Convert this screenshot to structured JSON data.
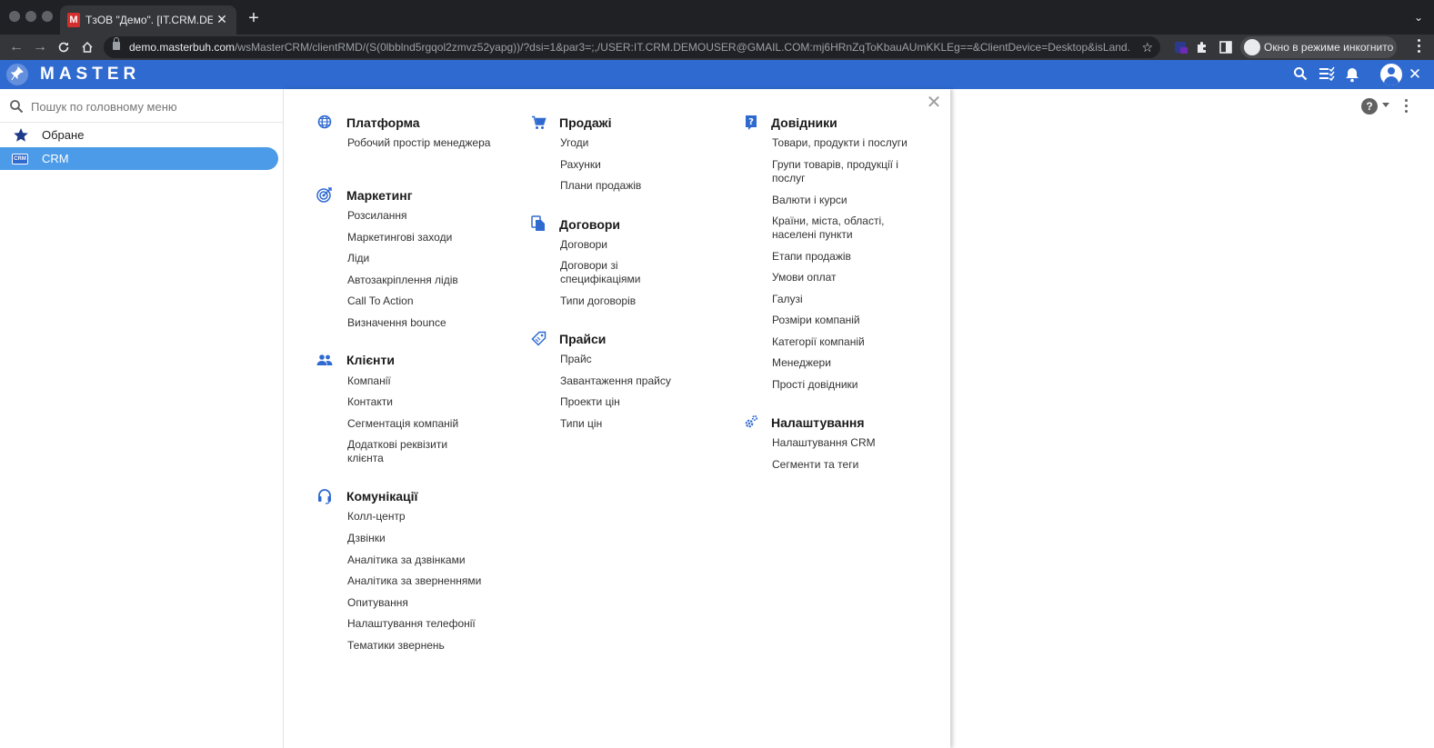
{
  "browser": {
    "tab_title": "ТзОВ \"Демо\". [IT.CRM.DEMOUSER",
    "tab_favicon": "M",
    "new_tab": "+",
    "url_host": "demo.masterbuh.com",
    "url_path": "/wsMasterCRM/clientRMD/(S(0lbblnd5rgqol2zmvz52yapg))/?dsi=1&par3=;,/USER:IT.CRM.DEMOUSER@GMAIL.COM:mj6HRnZqToKbauAUmKKLEg==&ClientDevice=Desktop&isLand...",
    "incognito_label": "Окно в режиме инкогнито"
  },
  "app": {
    "logo_text": "MASTER",
    "accent_color": "#2f6ad0"
  },
  "sidebar": {
    "search_placeholder": "Пошук по головному меню",
    "items": [
      {
        "label": "Обране",
        "icon": "star-icon"
      },
      {
        "label": "CRM",
        "icon": "crm-icon",
        "badge": "CRM",
        "active": true
      }
    ]
  },
  "menu": {
    "columns": [
      [
        {
          "title": "Платформа",
          "icon": "globe-icon",
          "items": [
            "Робочий простір менеджера"
          ]
        },
        {
          "title": "Маркетинг",
          "icon": "target-icon",
          "items": [
            "Розсилання",
            "Маркетингові заходи",
            "Ліди",
            "Автозакріплення лідів",
            "Call To Action",
            "Визначення bounce"
          ]
        },
        {
          "title": "Клієнти",
          "icon": "people-icon",
          "items": [
            "Компанії",
            "Контакти",
            "Сегментація компаній",
            "Додаткові реквізити клієнта"
          ]
        },
        {
          "title": "Комунікації",
          "icon": "headset-icon",
          "items": [
            "Колл-центр",
            "Дзвінки",
            "Аналітика за дзвінками",
            "Аналітика за зверненнями",
            "Опитування",
            "Налаштування телефонії",
            "Тематики звернень"
          ]
        }
      ],
      [
        {
          "title": "Продажі",
          "icon": "cart-icon",
          "items": [
            "Угоди",
            "Рахунки",
            "Плани продажів"
          ]
        },
        {
          "title": "Договори",
          "icon": "documents-icon",
          "items": [
            "Договори",
            "Договори зі специфікаціями",
            "Типи договорів"
          ]
        },
        {
          "title": "Прайси",
          "icon": "price-tag-icon",
          "items": [
            "Прайс",
            "Завантаження прайсу",
            "Проекти цін",
            "Типи цін"
          ]
        }
      ],
      [
        {
          "title": "Довідники",
          "icon": "help-book-icon",
          "items": [
            "Товари, продукти і послуги",
            "Групи товарів, продукції і послуг",
            "Валюти і курси",
            "Країни, міста, області, населені пункти",
            "Етапи продажів",
            "Умови оплат",
            "Галузі",
            "Розміри компаній",
            "Категорії компаній",
            "Менеджери",
            "Прості довідники"
          ]
        },
        {
          "title": "Налаштування",
          "icon": "gears-icon",
          "items": [
            "Налаштування CRM",
            "Сегменти та теги"
          ]
        }
      ]
    ]
  }
}
